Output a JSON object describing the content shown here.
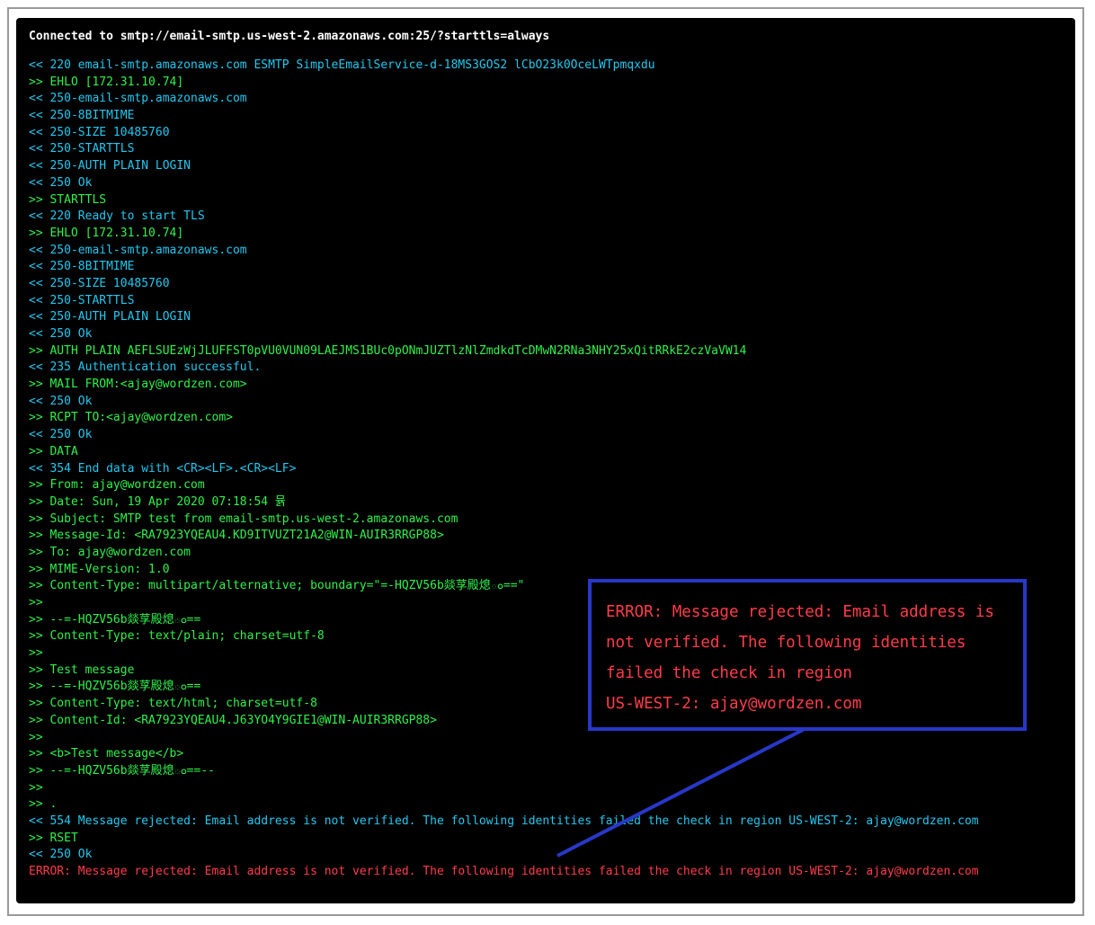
{
  "terminal": {
    "header": "Connected to smtp://email-smtp.us-west-2.amazonaws.com:25/?starttls=always",
    "lines": [
      {
        "text": "<< 220 email-smtp.amazonaws.com ESMTP SimpleEmailService-d-18MS3GOS2 lCbO23k0OceLWTpmqxdu",
        "kind": "in"
      },
      {
        "text": ">> EHLO [172.31.10.74]",
        "kind": "out"
      },
      {
        "text": "<< 250-email-smtp.amazonaws.com",
        "kind": "in"
      },
      {
        "text": "<< 250-8BITMIME",
        "kind": "in"
      },
      {
        "text": "<< 250-SIZE 10485760",
        "kind": "in"
      },
      {
        "text": "<< 250-STARTTLS",
        "kind": "in"
      },
      {
        "text": "<< 250-AUTH PLAIN LOGIN",
        "kind": "in"
      },
      {
        "text": "<< 250 Ok",
        "kind": "in"
      },
      {
        "text": ">> STARTTLS",
        "kind": "out"
      },
      {
        "text": "<< 220 Ready to start TLS",
        "kind": "in"
      },
      {
        "text": ">> EHLO [172.31.10.74]",
        "kind": "out"
      },
      {
        "text": "<< 250-email-smtp.amazonaws.com",
        "kind": "in"
      },
      {
        "text": "<< 250-8BITMIME",
        "kind": "in"
      },
      {
        "text": "<< 250-SIZE 10485760",
        "kind": "in"
      },
      {
        "text": "<< 250-STARTTLS",
        "kind": "in"
      },
      {
        "text": "<< 250-AUTH PLAIN LOGIN",
        "kind": "in"
      },
      {
        "text": "<< 250 Ok",
        "kind": "in"
      },
      {
        "text": ">> AUTH PLAIN AEFLSUEzWjJLUFFST0pVU0VUN09LAEJMS1BUc0pONmJUZTlzNlZmdkdTcDMwN2RNa3NHY25xQitRRkE2czVaVW14",
        "kind": "out"
      },
      {
        "text": "<< 235 Authentication successful.",
        "kind": "in"
      },
      {
        "text": ">> MAIL FROM:<ajay@wordzen.com>",
        "kind": "out"
      },
      {
        "text": "<< 250 Ok",
        "kind": "in"
      },
      {
        "text": ">> RCPT TO:<ajay@wordzen.com>",
        "kind": "out"
      },
      {
        "text": "<< 250 Ok",
        "kind": "in"
      },
      {
        "text": ">> DATA",
        "kind": "out"
      },
      {
        "text": "<< 354 End data with <CR><LF>.<CR><LF>",
        "kind": "in"
      },
      {
        "text": ">> From: ajay@wordzen.com",
        "kind": "out"
      },
      {
        "text": ">> Date: Sun, 19 Apr 2020 07:18:54 뮭",
        "kind": "out"
      },
      {
        "text": ">> Subject: SMTP test from email-smtp.us-west-2.amazonaws.com",
        "kind": "out"
      },
      {
        "text": ">> Message-Id: <RA7923YQEAU4.KD9ITVUZT21A2@WIN-AUIR3RRGP88>",
        "kind": "out"
      },
      {
        "text": ">> To: ajay@wordzen.com",
        "kind": "out"
      },
      {
        "text": ">> MIME-Version: 1.0",
        "kind": "out"
      },
      {
        "text": ">> Content-Type: multipart/alternative; boundary=\"=-HQZV56b燚莩殿熄ం==\"",
        "kind": "out"
      },
      {
        "text": ">>",
        "kind": "out"
      },
      {
        "text": ">> --=-HQZV56b燚莩殿熄ం==",
        "kind": "out"
      },
      {
        "text": ">> Content-Type: text/plain; charset=utf-8",
        "kind": "out"
      },
      {
        "text": ">>",
        "kind": "out"
      },
      {
        "text": ">> Test message",
        "kind": "out"
      },
      {
        "text": ">> --=-HQZV56b燚莩殿熄ం==",
        "kind": "out"
      },
      {
        "text": ">> Content-Type: text/html; charset=utf-8",
        "kind": "out"
      },
      {
        "text": ">> Content-Id: <RA7923YQEAU4.J63YO4Y9GIE1@WIN-AUIR3RRGP88>",
        "kind": "out"
      },
      {
        "text": ">>",
        "kind": "out"
      },
      {
        "text": ">> <b>Test message</b>",
        "kind": "out"
      },
      {
        "text": ">> --=-HQZV56b燚莩殿熄ం==--",
        "kind": "out"
      },
      {
        "text": ">>",
        "kind": "out"
      },
      {
        "text": ">> .",
        "kind": "out"
      },
      {
        "text": "<< 554 Message rejected: Email address is not verified. The following identities failed the check in region US-WEST-2: ajay@wordzen.com",
        "kind": "in"
      },
      {
        "text": ">> RSET",
        "kind": "out"
      },
      {
        "text": "<< 250 Ok",
        "kind": "in"
      },
      {
        "text": "ERROR: Message rejected: Email address is not verified. The following identities failed the check in region US-WEST-2: ajay@wordzen.com",
        "kind": "err"
      }
    ]
  },
  "callout": {
    "lines": [
      "ERROR: Message rejected: Email address is",
      "not verified. The following identities",
      "failed the check in region",
      "US-WEST-2: ajay@wordzen.com"
    ]
  },
  "colors": {
    "incoming": "#22c8f0",
    "outgoing": "#2ef24a",
    "error": "#ff3b4a",
    "callout_border": "#2838c8",
    "background": "#000000"
  }
}
